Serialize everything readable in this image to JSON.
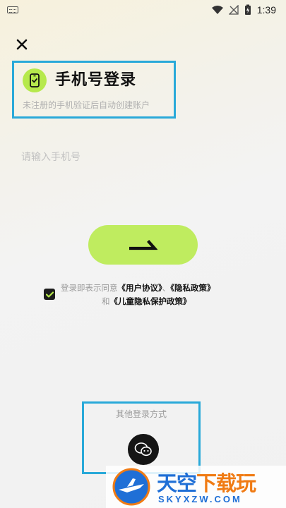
{
  "status_bar": {
    "time": "1:39"
  },
  "header": {
    "title": "手机号登录",
    "subtitle": "未注册的手机验证后自动创建账户"
  },
  "phone_input": {
    "placeholder": "请输入手机号",
    "value": ""
  },
  "agreement": {
    "prefix": "登录即表示同意",
    "user_agreement": "《用户协议》",
    "separator": "、",
    "privacy_policy": "《隐私政策》",
    "and": "和",
    "children_policy": "《儿童隐私保护政策》",
    "checked": true
  },
  "other_login": {
    "label": "其他登录方式",
    "wechat_icon": "wechat-icon"
  },
  "watermark": {
    "brand_part1": "天空",
    "brand_part2": "下载玩",
    "domain": "SKYXZW.COM"
  },
  "colors": {
    "accent_green": "#bfec5f",
    "highlight_box": "#29a9d9",
    "dark": "#151515"
  }
}
